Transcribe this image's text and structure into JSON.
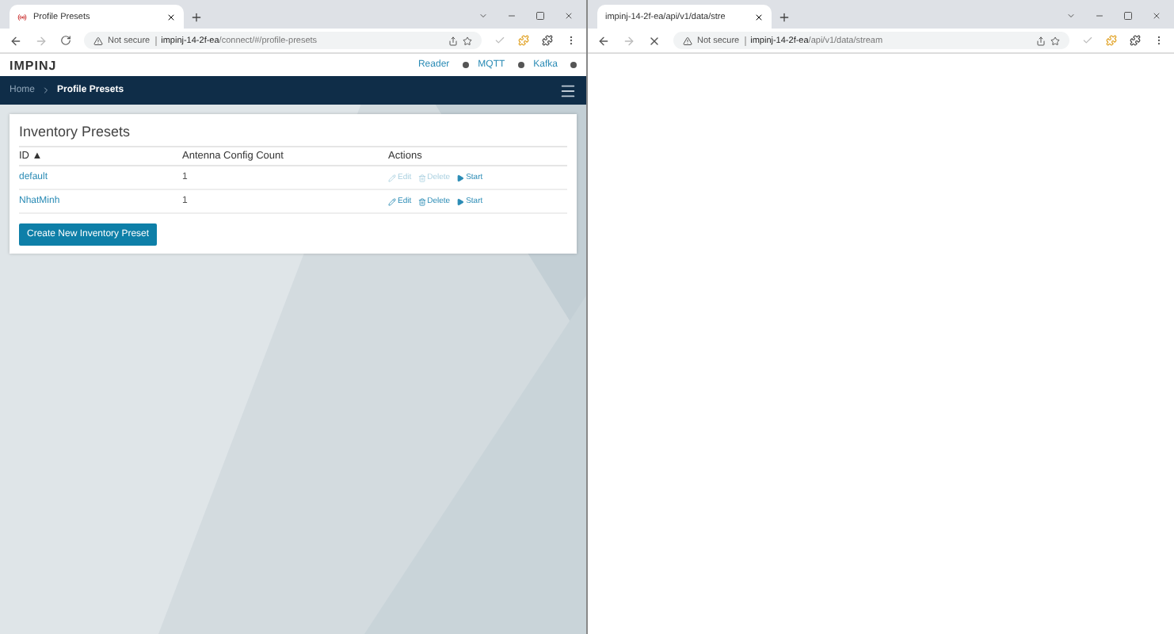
{
  "windows": [
    {
      "tab": {
        "title": "Profile Presets"
      },
      "loading": false,
      "address": {
        "security": "Not secure",
        "host": "impinj-14-2f-ea",
        "path": "/connect/#/profile-presets"
      },
      "page": {
        "kind": "app",
        "logo": "IMPINJ",
        "statuses": [
          {
            "label": "Reader",
            "color": "#555555"
          },
          {
            "label": "MQTT",
            "color": "#555555"
          },
          {
            "label": "Kafka",
            "color": "#555555"
          }
        ],
        "breadcrumb": [
          {
            "label": "Home",
            "selected": false
          },
          {
            "label": "Profile Presets",
            "selected": true
          }
        ],
        "card": {
          "title": "Inventory Presets",
          "columns": [
            {
              "label": "ID",
              "sort": "▲"
            },
            {
              "label": "Antenna Config Count"
            },
            {
              "label": "Actions"
            }
          ],
          "rows": [
            {
              "id": "default",
              "count": "1",
              "actions": [
                {
                  "kind": "edit",
                  "label": "Edit",
                  "disabled": true
                },
                {
                  "kind": "delete",
                  "label": "Delete",
                  "disabled": true
                },
                {
                  "kind": "start",
                  "label": "Start",
                  "disabled": false
                }
              ]
            },
            {
              "id": "NhatMinh",
              "count": "1",
              "actions": [
                {
                  "kind": "edit",
                  "label": "Edit",
                  "disabled": false
                },
                {
                  "kind": "delete",
                  "label": "Delete",
                  "disabled": false
                },
                {
                  "kind": "start",
                  "label": "Start",
                  "disabled": false
                }
              ]
            }
          ],
          "button": "Create New Inventory Preset"
        }
      }
    },
    {
      "tab": {
        "title": "impinj-14-2f-ea/api/v1/data/stre"
      },
      "loading": true,
      "address": {
        "security": "Not secure",
        "host": "impinj-14-2f-ea",
        "path": "/api/v1/data/stream"
      },
      "page": {
        "kind": "blank"
      }
    }
  ]
}
